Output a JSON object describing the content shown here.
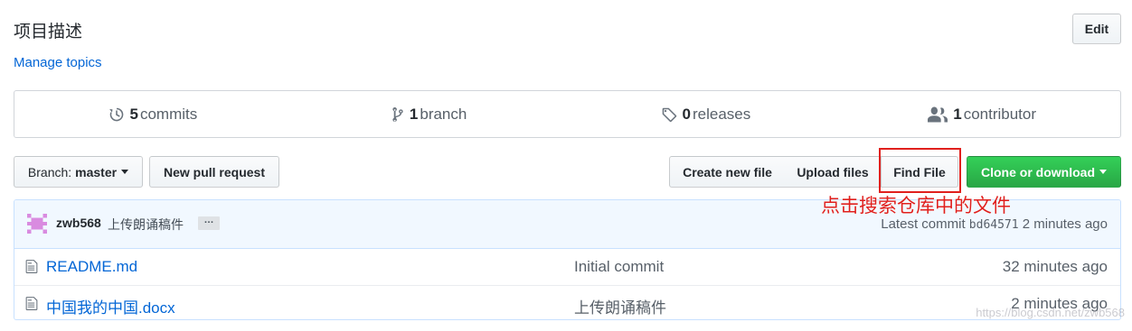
{
  "repo": {
    "description": "项目描述",
    "edit_label": "Edit",
    "manage_topics": "Manage topics"
  },
  "numbers": [
    {
      "count": "5",
      "label": "commits",
      "icon": "history-icon"
    },
    {
      "count": "1",
      "label": "branch",
      "icon": "git-branch-icon"
    },
    {
      "count": "0",
      "label": "releases",
      "icon": "tag-icon"
    },
    {
      "count": "1",
      "label": "contributor",
      "icon": "people-icon"
    }
  ],
  "toolbar": {
    "branch_prefix": "Branch:",
    "branch_name": "master",
    "new_pull_request": "New pull request",
    "create_new_file": "Create new file",
    "upload_files": "Upload files",
    "find_file": "Find File",
    "clone_or_download": "Clone or download"
  },
  "annotation": "点击搜索仓库中的文件",
  "commit": {
    "author": "zwb568",
    "message": "上传朗诵稿件",
    "ellipsis": "…",
    "latest_prefix": "Latest commit",
    "sha": "bd64571",
    "age": "2 minutes ago"
  },
  "files": [
    {
      "name": "README.md",
      "message": "Initial commit",
      "age": "32 minutes ago"
    },
    {
      "name": "中国我的中国.docx",
      "message": "上传朗诵稿件",
      "age": "2 minutes ago"
    }
  ],
  "watermark": "https://blog.csdn.net/zwb568",
  "colors": {
    "link": "#0366d6",
    "clone_green": "#28a745",
    "annotation_red": "#e0201d",
    "commit_bg": "#f1f8ff"
  }
}
